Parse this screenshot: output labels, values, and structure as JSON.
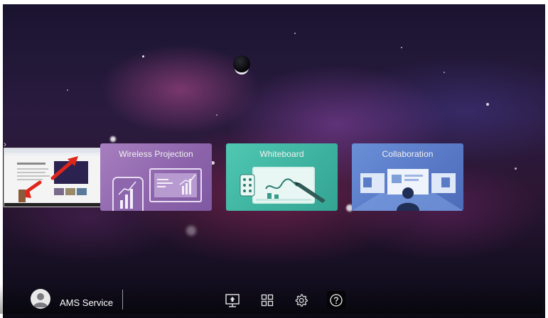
{
  "launcher": {
    "collapse_arrow": "›",
    "preview": {
      "icon": "screen-preview-thumbnail"
    },
    "cards": [
      {
        "id": "wireless",
        "label": "Wireless Projection",
        "color": "#9a72b8",
        "icon": "phone-to-display-illustration"
      },
      {
        "id": "whiteboard",
        "label": "Whiteboard",
        "color": "#40b8a4",
        "icon": "whiteboard-pen-illustration"
      },
      {
        "id": "collab",
        "label": "Collaboration",
        "color": "#5e80cc",
        "icon": "shared-screen-illustration"
      }
    ]
  },
  "taskbar": {
    "user_name": "AMS Service",
    "avatar_icon": "user-avatar-icon",
    "buttons": [
      {
        "name": "screen-share",
        "icon": "screen-share-icon"
      },
      {
        "name": "apps",
        "icon": "app-grid-icon"
      },
      {
        "name": "settings",
        "icon": "gear-icon"
      },
      {
        "name": "help",
        "icon": "question-mark-icon"
      }
    ]
  }
}
